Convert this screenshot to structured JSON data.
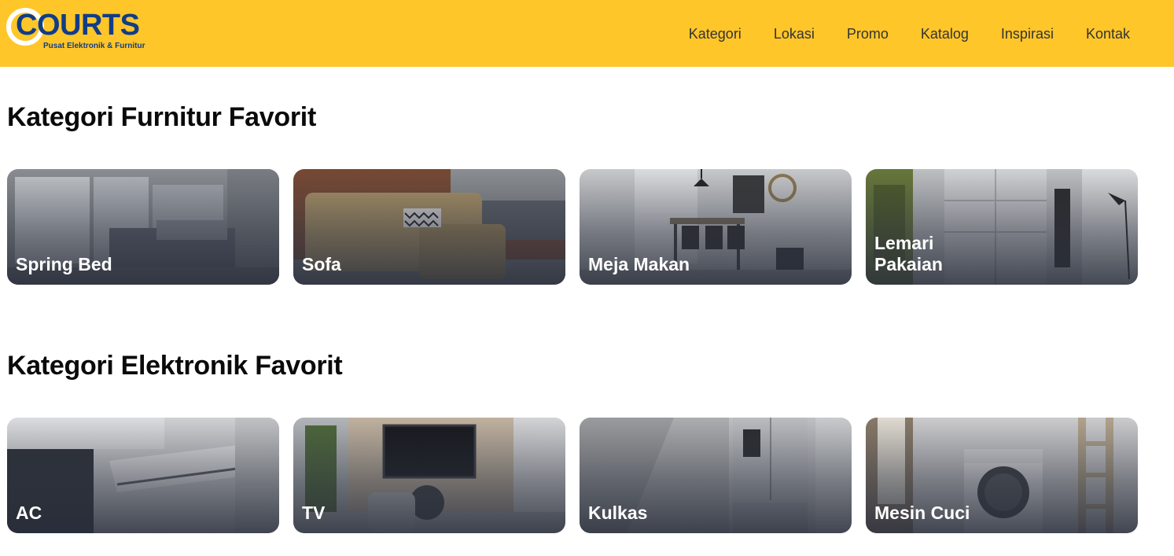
{
  "brand": {
    "name": "COURTS",
    "tagline": "Pusat Elektronik & Furnitur",
    "colors": {
      "header": "#ffc629",
      "logo": "#123d86"
    }
  },
  "nav": [
    "Kategori",
    "Lokasi",
    "Promo",
    "Katalog",
    "Inspirasi",
    "Kontak"
  ],
  "furniture": {
    "title": "Kategori Furnitur Favorit",
    "items": [
      {
        "label": "Spring Bed",
        "image": "bedroom-photo"
      },
      {
        "label": "Sofa",
        "image": "sofa-photo"
      },
      {
        "label": "Meja Makan",
        "image": "dining-table-photo"
      },
      {
        "label": "Lemari Pakaian",
        "image": "wardrobe-photo"
      }
    ]
  },
  "electronics": {
    "title": "Kategori Elektronik Favorit",
    "items": [
      {
        "label": "AC",
        "image": "air-conditioner-photo"
      },
      {
        "label": "TV",
        "image": "television-photo"
      },
      {
        "label": "Kulkas",
        "image": "refrigerator-photo"
      },
      {
        "label": "Mesin Cuci",
        "image": "washing-machine-photo"
      }
    ]
  }
}
